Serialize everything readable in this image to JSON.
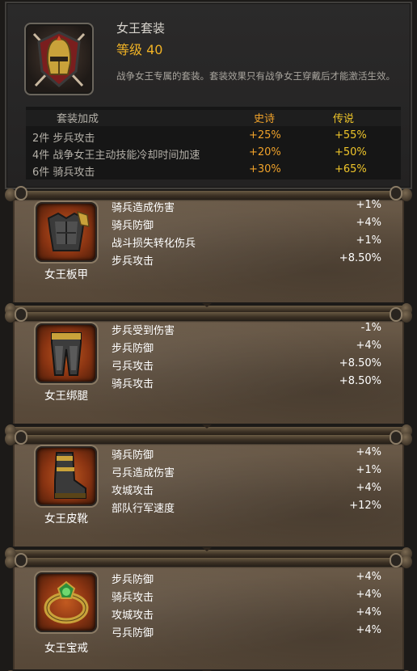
{
  "set": {
    "name": "女王套装",
    "level": "等级 40",
    "description": "战争女王专属的套装。套装效果只有战争女王穿戴后才能激活生效。",
    "bonus_header": {
      "label": "套装加成",
      "epic": "史诗",
      "legendary": "传说"
    },
    "bonuses": [
      {
        "label": "2件 步兵攻击",
        "epic": "+25%",
        "legendary": "+55%"
      },
      {
        "label": "4件 战争女王主动技能冷却时间加速",
        "epic": "+20%",
        "legendary": "+50%"
      },
      {
        "label": "6件 骑兵攻击",
        "epic": "+30%",
        "legendary": "+65%"
      }
    ],
    "icon": "queen-helmet-emblem-icon"
  },
  "pieces": [
    {
      "name": "女王板甲",
      "icon": "armor-icon",
      "stats": [
        {
          "name": "骑兵造成伤害",
          "value": "+1%"
        },
        {
          "name": "骑兵防御",
          "value": "+4%"
        },
        {
          "name": "战斗损失转化伤兵",
          "value": "+1%"
        },
        {
          "name": "步兵攻击",
          "value": "+8.50%"
        }
      ]
    },
    {
      "name": "女王绑腿",
      "icon": "leggings-icon",
      "stats": [
        {
          "name": "步兵受到伤害",
          "value": "-1%"
        },
        {
          "name": "步兵防御",
          "value": "+4%"
        },
        {
          "name": "弓兵攻击",
          "value": "+8.50%"
        },
        {
          "name": "骑兵攻击",
          "value": "+8.50%"
        }
      ]
    },
    {
      "name": "女王皮靴",
      "icon": "boots-icon",
      "stats": [
        {
          "name": "骑兵防御",
          "value": "+4%"
        },
        {
          "name": "弓兵造成伤害",
          "value": "+1%"
        },
        {
          "name": "攻城攻击",
          "value": "+4%"
        },
        {
          "name": "部队行军速度",
          "value": "+12%"
        }
      ]
    },
    {
      "name": "女王宝戒",
      "icon": "ring-icon",
      "stats": [
        {
          "name": "步兵防御",
          "value": "+4%"
        },
        {
          "name": "骑兵攻击",
          "value": "+4%"
        },
        {
          "name": "攻城攻击",
          "value": "+4%"
        },
        {
          "name": "弓兵防御",
          "value": "+4%"
        }
      ]
    }
  ]
}
